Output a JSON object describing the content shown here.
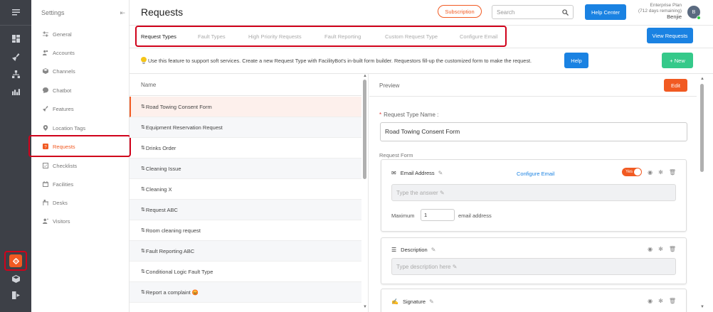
{
  "rail": {
    "icons": [
      "menu-icon",
      "dashboard-icon",
      "broom-icon",
      "hierarchy-icon",
      "analytics-icon",
      "settings-icon",
      "cube-icon",
      "logout-icon"
    ]
  },
  "sidebar": {
    "title": "Settings",
    "items": [
      {
        "label": "General",
        "icon": "sliders-icon"
      },
      {
        "label": "Accounts",
        "icon": "users-icon"
      },
      {
        "label": "Channels",
        "icon": "cube-icon"
      },
      {
        "label": "Chatbot",
        "icon": "chat-icon"
      },
      {
        "label": "Features",
        "icon": "broom-icon"
      },
      {
        "label": "Location Tags",
        "icon": "pin-icon"
      },
      {
        "label": "Requests",
        "icon": "question-icon"
      },
      {
        "label": "Checklists",
        "icon": "checklist-icon"
      },
      {
        "label": "Facilities",
        "icon": "calendar-icon"
      },
      {
        "label": "Desks",
        "icon": "desk-icon"
      },
      {
        "label": "Visitors",
        "icon": "visitor-icon"
      }
    ],
    "active_index": 6
  },
  "header": {
    "title": "Requests",
    "subscription": "Subscription",
    "search_placeholder": "Search",
    "help_center": "Help Center",
    "plan": "Enterprise Plan",
    "plan_days": "(712 days remaining)",
    "user": "Benjie",
    "avatar_initial": "B"
  },
  "tabs": [
    {
      "label": "Request Types",
      "active": true
    },
    {
      "label": "Fault Types",
      "active": false
    },
    {
      "label": "High Priority Requests",
      "active": false
    },
    {
      "label": "Fault Reporting",
      "active": false
    },
    {
      "label": "Custom Request Type",
      "active": false
    },
    {
      "label": "Configure Email",
      "active": false
    }
  ],
  "view_requests": "View Requests",
  "info": {
    "text": "Use this feature to support soft services. Create a new Request Type with FacilityBot's in-built form builder. Requestors fill-up the customized form to make the request.",
    "help": "Help",
    "new": "+ New"
  },
  "list": {
    "header": "Name",
    "rows": [
      "Road Towing Consent Form",
      "Equipment Reservation Request",
      "Drinks Order",
      "Cleaning Issue",
      "Cleaning X",
      "Request ABC",
      "Room cleaning request",
      "Fault Reporting ABC",
      "Conditional Logic Fault Type",
      "Report a complaint 😡"
    ],
    "selected_index": 0
  },
  "preview": {
    "title": "Preview",
    "edit": "Edit",
    "name_label": "Request Type Name :",
    "name_value": "Road Towing Consent Form",
    "form_label": "Request Form",
    "fields": {
      "email": {
        "title": "Email Address",
        "configure": "Configure Email",
        "toggle": "Yes",
        "placeholder": "Type the answer",
        "max_label": "Maximum",
        "max_value": "1",
        "max_suffix": "email address"
      },
      "description": {
        "title": "Description",
        "placeholder": "Type description here"
      },
      "signature": {
        "title": "Signature"
      }
    }
  },
  "colors": {
    "accent": "#f15a22",
    "primary": "#1a82e2",
    "success": "#35c98a",
    "highlight": "#d0021b",
    "rail": "#3d4047"
  }
}
